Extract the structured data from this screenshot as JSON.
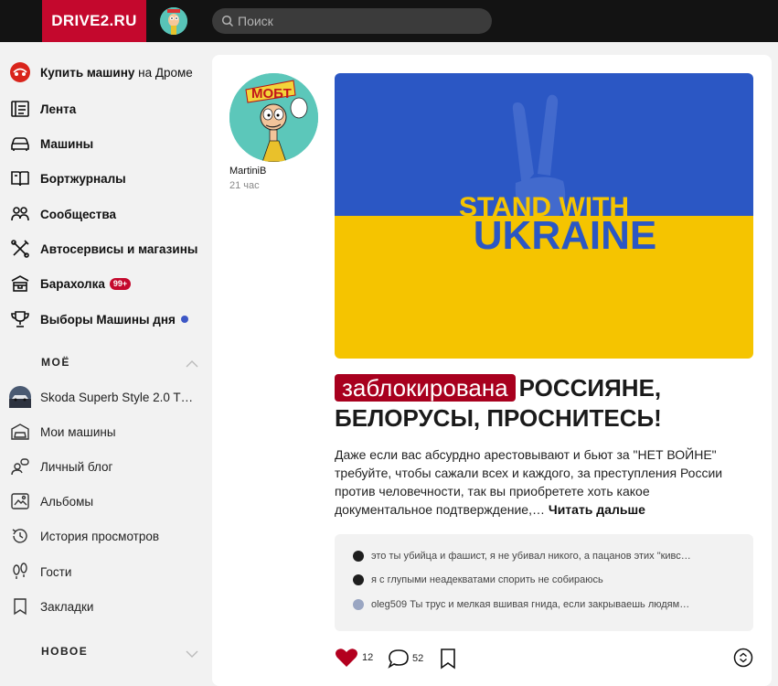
{
  "header": {
    "logo": "DRIVE2.RU",
    "search_placeholder": "Поиск"
  },
  "sidebar": {
    "items": [
      {
        "bold": "Купить машину",
        "rest": " на Дроме",
        "icon": "drom-logo-icon"
      },
      {
        "label": "Лента",
        "icon": "feed-icon"
      },
      {
        "label": "Машины",
        "icon": "car-icon"
      },
      {
        "label": "Бортжурналы",
        "icon": "book-icon"
      },
      {
        "label": "Сообщества",
        "icon": "people-icon"
      },
      {
        "label": "Автосервисы и магазины",
        "icon": "tools-icon"
      },
      {
        "label": "Барахолка",
        "icon": "market-icon",
        "badge": "99+"
      },
      {
        "label": "Выборы Машины дня",
        "icon": "trophy-icon"
      }
    ],
    "mine_title": "МОЁ",
    "mine_items": [
      {
        "label": "Skoda Superb Style 2.0 T…",
        "icon": "car-thumbnail"
      },
      {
        "label": "Мои машины",
        "icon": "garage-icon"
      },
      {
        "label": "Личный блог",
        "icon": "blog-icon"
      },
      {
        "label": "Альбомы",
        "icon": "album-icon"
      },
      {
        "label": "История просмотров",
        "icon": "history-icon"
      },
      {
        "label": "Гости",
        "icon": "footprints-icon"
      },
      {
        "label": "Закладки",
        "icon": "bookmark-icon"
      }
    ],
    "new_title": "НОВОЕ"
  },
  "post": {
    "author": "MartiniB",
    "time": "21 час",
    "avatar_caption": "МОБТ",
    "banner_line1": "STAND WITH",
    "banner_line2": "UKRAINE",
    "blocked_label": "заблокирована",
    "title": "РОССИЯНЕ, БЕЛОРУСЫ, ПРОСНИТЕСЬ!",
    "description": "Даже если вас абсурдно арестовывают и бьют за \"НЕТ ВОЙНЕ\" требуйте, чтобы сажали всех и каждого, за преступления России против человечности, так вы приобретете хоть какое документальное подтверждение,…",
    "read_more": "Читать дальше",
    "comments": [
      {
        "text": "это ты убийца и фашист, я не убивал никого, а пацанов этих \"кивс…"
      },
      {
        "text": "я с глупыми неадекватами спорить не собираюсь"
      },
      {
        "text": "oleg509 Ты трус и мелкая вшивая гнида, если закрываешь людям…"
      }
    ],
    "likes": "12",
    "comments_count": "52"
  },
  "colors": {
    "brand": "#c4082d",
    "flag_blue": "#2b57c4",
    "flag_yellow": "#f5c400",
    "dark": "#131313"
  }
}
